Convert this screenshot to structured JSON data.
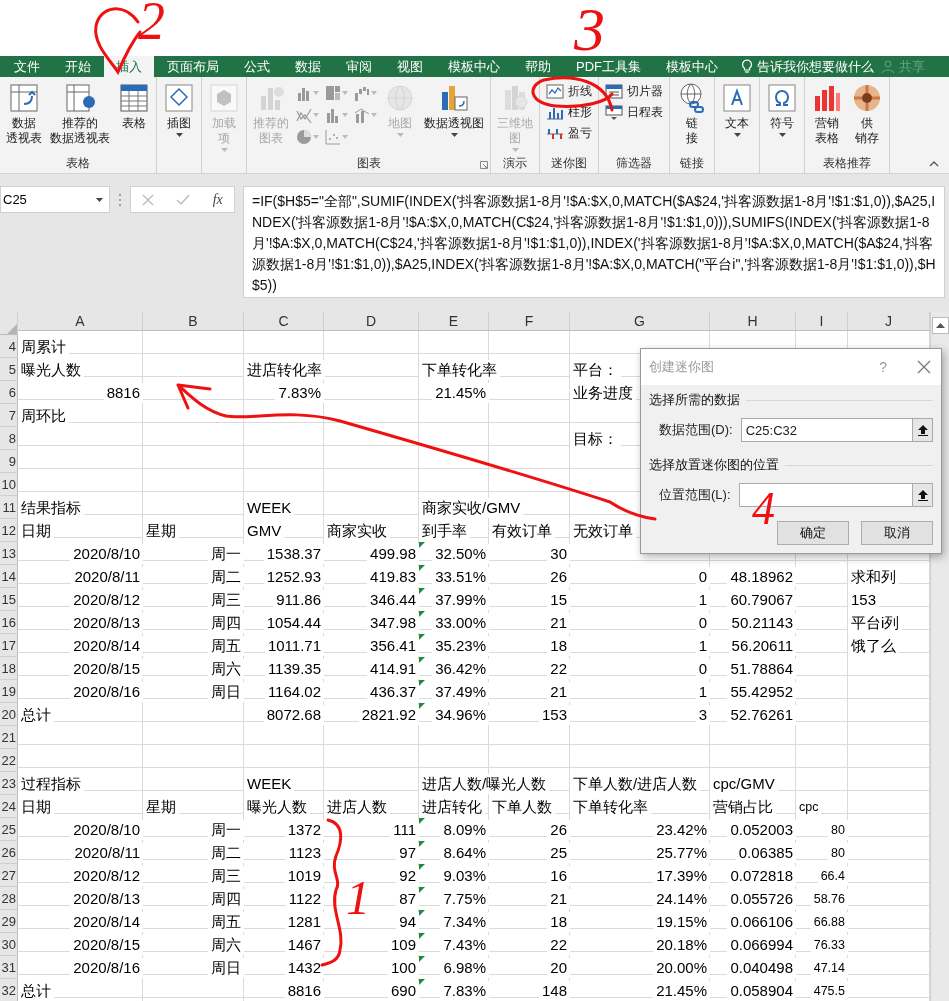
{
  "tabs": [
    {
      "label": "文件",
      "selected": false
    },
    {
      "label": "开始",
      "selected": false
    },
    {
      "label": "插入",
      "selected": true
    },
    {
      "label": "页面布局",
      "selected": false
    },
    {
      "label": "公式",
      "selected": false
    },
    {
      "label": "数据",
      "selected": false
    },
    {
      "label": "审阅",
      "selected": false
    },
    {
      "label": "视图",
      "selected": false
    },
    {
      "label": "模板中心",
      "selected": false
    },
    {
      "label": "帮助",
      "selected": false
    },
    {
      "label": "PDF工具集",
      "selected": false
    },
    {
      "label": "模板中心",
      "selected": false
    }
  ],
  "tell_me": "告诉我你想要做什么",
  "share": "共享",
  "ribbon": {
    "groups": [
      {
        "label": "表格",
        "launcher": false,
        "buttons": [
          {
            "kind": "large",
            "label": [
              "数据",
              "透视表"
            ],
            "disabled": false,
            "dropdown": false
          },
          {
            "kind": "large",
            "label": [
              "推荐的",
              "数据透视表"
            ],
            "disabled": false,
            "dropdown": false
          },
          {
            "kind": "large",
            "label": [
              "表格"
            ],
            "disabled": false,
            "dropdown": false
          }
        ]
      },
      {
        "launcher": false,
        "buttons": [
          {
            "kind": "large",
            "label": [
              "插图"
            ],
            "disabled": false,
            "dropdown": true
          }
        ]
      },
      {
        "launcher": false,
        "buttons": [
          {
            "kind": "large",
            "label": [
              "加载",
              "项"
            ],
            "disabled": true,
            "dropdown": true
          }
        ]
      },
      {
        "label": "图表",
        "launcher": true,
        "buttons": [
          {
            "kind": "large",
            "label": [
              "推荐的",
              "图表"
            ],
            "disabled": true,
            "dropdown": false
          },
          {
            "kind": "icon",
            "disabled": true,
            "dropdown": true
          },
          {
            "kind": "icon",
            "disabled": true,
            "dropdown": true
          },
          {
            "kind": "icon",
            "disabled": true,
            "dropdown": true
          },
          {
            "kind": "icon",
            "disabled": true,
            "dropdown": true
          },
          {
            "kind": "icon",
            "disabled": true,
            "dropdown": true
          },
          {
            "kind": "icon",
            "disabled": true,
            "dropdown": true
          },
          {
            "kind": "icon",
            "disabled": true,
            "dropdown": true
          },
          {
            "kind": "icon",
            "disabled": true,
            "dropdown": true
          },
          {
            "kind": "large",
            "label": [
              "地图"
            ],
            "disabled": true,
            "dropdown": true
          },
          {
            "kind": "large",
            "label": [
              "数据透视图"
            ],
            "disabled": false,
            "dropdown": true
          }
        ]
      },
      {
        "label": "演示",
        "launcher": false,
        "buttons": [
          {
            "kind": "large",
            "label": [
              "三维地",
              "图"
            ],
            "disabled": true,
            "dropdown": true
          }
        ]
      },
      {
        "label": "迷你图",
        "launcher": false,
        "buttons": [
          {
            "kind": "small",
            "label": [
              "折线"
            ],
            "disabled": false,
            "dropdown": false
          },
          {
            "kind": "small",
            "label": [
              "柱形"
            ],
            "disabled": false,
            "dropdown": false
          },
          {
            "kind": "small",
            "label": [
              "盈亏"
            ],
            "disabled": false,
            "dropdown": false
          }
        ]
      },
      {
        "label": "筛选器",
        "launcher": false,
        "buttons": [
          {
            "kind": "small",
            "label": [
              "切片器"
            ],
            "disabled": false,
            "dropdown": false
          },
          {
            "kind": "small",
            "label": [
              "日程表"
            ],
            "disabled": false,
            "dropdown": false
          }
        ]
      },
      {
        "label": "链接",
        "launcher": false,
        "buttons": [
          {
            "kind": "large",
            "label": [
              "链",
              "接"
            ],
            "disabled": false,
            "dropdown": false
          }
        ]
      },
      {
        "launcher": false,
        "buttons": [
          {
            "kind": "large",
            "label": [
              "文本"
            ],
            "disabled": false,
            "dropdown": true
          }
        ]
      },
      {
        "launcher": false,
        "buttons": [
          {
            "kind": "large",
            "label": [
              "符号"
            ],
            "disabled": false,
            "dropdown": true
          }
        ]
      },
      {
        "label": "表格推荐",
        "launcher": false,
        "buttons": [
          {
            "kind": "large",
            "label": [
              "营销",
              "表格"
            ],
            "disabled": false,
            "dropdown": false
          },
          {
            "kind": "large",
            "label": [
              "供",
              "销存"
            ],
            "disabled": false,
            "dropdown": false
          }
        ]
      }
    ]
  },
  "formula_bar": {
    "name_box": "C25",
    "function_label": "fx",
    "formula": "=IF($H$5=\"全部\",SUMIF(INDEX('抖客源数据1-8月'!$A:$X,0,MATCH($A$24,'抖客源数据1-8月'!$1:$1,0)),$A25,INDEX('抖客源数据1-8月'!$A:$X,0,MATCH(C$24,'抖客源数据1-8月'!$1:$1,0))),SUMIFS(INDEX('抖客源数据1-8月'!$A:$X,0,MATCH(C$24,'抖客源数据1-8月'!$1:$1,0)),INDEX('抖客源数据1-8月'!$A:$X,0,MATCH($A$24,'抖客源数据1-8月'!$1:$1,0)),$A25,INDEX('抖客源数据1-8月'!$A:$X,0,MATCH(\"平台i\",'抖客源数据1-8月'!$1:$1,0)),$H$5))"
  },
  "sheet": {
    "columns": [
      "A",
      "B",
      "C",
      "D",
      "E",
      "F",
      "G",
      "H",
      "I",
      "J"
    ],
    "rows": [
      {
        "number": "4",
        "kind": "text",
        "error_flag": false,
        "cells": [
          "周累计",
          null,
          null,
          null,
          null,
          null,
          null,
          null,
          null,
          null
        ]
      },
      {
        "number": "5",
        "kind": "text",
        "error_flag": false,
        "cells": [
          "曝光人数",
          null,
          "进店转化率",
          null,
          "下单转化率",
          null,
          "平台：",
          null,
          null,
          null
        ]
      },
      {
        "number": "6",
        "kind": "summary",
        "error_flag": false,
        "cells": [
          "8816",
          null,
          "7.83%",
          null,
          "21.45%",
          null,
          "业务进度",
          null,
          null,
          null
        ]
      },
      {
        "number": "7",
        "kind": "text",
        "error_flag": false,
        "cells": [
          "周环比",
          null,
          null,
          null,
          null,
          null,
          null,
          null,
          null,
          null
        ]
      },
      {
        "number": "8",
        "kind": "text",
        "error_flag": false,
        "cells": [
          null,
          null,
          null,
          null,
          null,
          null,
          "目标：",
          null,
          null,
          null
        ]
      },
      {
        "number": "9",
        "kind": "text",
        "error_flag": false,
        "cells": [
          null,
          null,
          null,
          null,
          null,
          null,
          null,
          null,
          null,
          null
        ]
      },
      {
        "number": "10",
        "kind": "text",
        "error_flag": false,
        "cells": [
          null,
          null,
          null,
          null,
          null,
          null,
          null,
          null,
          null,
          null
        ]
      },
      {
        "number": "11",
        "kind": "text",
        "error_flag": false,
        "cells": [
          "结果指标",
          null,
          "WEEK",
          null,
          "商家实收/GMV",
          null,
          null,
          null,
          null,
          null
        ]
      },
      {
        "number": "12",
        "kind": "text",
        "error_flag": false,
        "cells": [
          "日期",
          "星期",
          "GMV",
          "商家实收",
          "到手率",
          "有效订单",
          "无效订单",
          null,
          null,
          null
        ]
      },
      {
        "number": "13",
        "kind": "data",
        "error_flag": true,
        "cells": [
          "2020/8/10",
          "周一",
          "1538.37",
          "499.98",
          "32.50%",
          "30",
          null,
          null,
          null,
          null
        ]
      },
      {
        "number": "14",
        "kind": "data",
        "error_flag": true,
        "cells": [
          "2020/8/11",
          "周二",
          "1252.93",
          "419.83",
          "33.51%",
          "26",
          "0",
          "48.18962",
          null,
          "求和列"
        ]
      },
      {
        "number": "15",
        "kind": "data",
        "error_flag": true,
        "cells": [
          "2020/8/12",
          "周三",
          "911.86",
          "346.44",
          "37.99%",
          "15",
          "1",
          "60.79067",
          null,
          "153"
        ]
      },
      {
        "number": "16",
        "kind": "data",
        "error_flag": true,
        "cells": [
          "2020/8/13",
          "周四",
          "1054.44",
          "347.98",
          "33.00%",
          "21",
          "0",
          "50.21143",
          null,
          "平台i列"
        ]
      },
      {
        "number": "17",
        "kind": "data",
        "error_flag": true,
        "cells": [
          "2020/8/14",
          "周五",
          "1011.71",
          "356.41",
          "35.23%",
          "18",
          "1",
          "56.20611",
          null,
          "饿了么"
        ]
      },
      {
        "number": "18",
        "kind": "data",
        "error_flag": true,
        "cells": [
          "2020/8/15",
          "周六",
          "1139.35",
          "414.91",
          "36.42%",
          "22",
          "0",
          "51.78864",
          null,
          null
        ]
      },
      {
        "number": "19",
        "kind": "data",
        "error_flag": true,
        "cells": [
          "2020/8/16",
          "周日",
          "1164.02",
          "436.37",
          "37.49%",
          "21",
          "1",
          "55.42952",
          null,
          null
        ]
      },
      {
        "number": "20",
        "kind": "total",
        "error_flag": true,
        "cells": [
          "总计",
          null,
          "8072.68",
          "2821.92",
          "34.96%",
          "153",
          "3",
          "52.76261",
          null,
          null
        ]
      },
      {
        "number": "21",
        "kind": "text",
        "error_flag": false,
        "cells": [
          null,
          null,
          null,
          null,
          null,
          null,
          null,
          null,
          null,
          null
        ]
      },
      {
        "number": "22",
        "kind": "text",
        "error_flag": false,
        "cells": [
          null,
          null,
          null,
          null,
          null,
          null,
          null,
          null,
          null,
          null
        ]
      },
      {
        "number": "23",
        "kind": "text",
        "error_flag": false,
        "cells": [
          "过程指标",
          null,
          "WEEK",
          null,
          "进店人数/曝光人数",
          null,
          "下单人数/进店人数",
          "cpc/GMV",
          null,
          null
        ]
      },
      {
        "number": "24",
        "kind": "text",
        "error_flag": false,
        "cells": [
          "日期",
          "星期",
          "曝光人数",
          "进店人数",
          "进店转化",
          "下单人数",
          "下单转化率",
          "营销占比",
          "cpc",
          null
        ]
      },
      {
        "number": "25",
        "kind": "data",
        "error_flag": true,
        "cells": [
          "2020/8/10",
          "周一",
          "1372",
          "111",
          "8.09%",
          "26",
          "23.42%",
          "0.052003",
          "80",
          null
        ]
      },
      {
        "number": "26",
        "kind": "data",
        "error_flag": true,
        "cells": [
          "2020/8/11",
          "周二",
          "1123",
          "97",
          "8.64%",
          "25",
          "25.77%",
          "0.06385",
          "80",
          null
        ]
      },
      {
        "number": "27",
        "kind": "data",
        "error_flag": true,
        "cells": [
          "2020/8/12",
          "周三",
          "1019",
          "92",
          "9.03%",
          "16",
          "17.39%",
          "0.072818",
          "66.4",
          null
        ]
      },
      {
        "number": "28",
        "kind": "data",
        "error_flag": true,
        "cells": [
          "2020/8/13",
          "周四",
          "1122",
          "87",
          "7.75%",
          "21",
          "24.14%",
          "0.055726",
          "58.76",
          null
        ]
      },
      {
        "number": "29",
        "kind": "data",
        "error_flag": true,
        "cells": [
          "2020/8/14",
          "周五",
          "1281",
          "94",
          "7.34%",
          "18",
          "19.15%",
          "0.066106",
          "66.88",
          null
        ]
      },
      {
        "number": "30",
        "kind": "data",
        "error_flag": true,
        "cells": [
          "2020/8/15",
          "周六",
          "1467",
          "109",
          "7.43%",
          "22",
          "20.18%",
          "0.066994",
          "76.33",
          null
        ]
      },
      {
        "number": "31",
        "kind": "data",
        "error_flag": true,
        "cells": [
          "2020/8/16",
          "周日",
          "1432",
          "100",
          "6.98%",
          "20",
          "20.00%",
          "0.040498",
          "47.14",
          null
        ]
      },
      {
        "number": "32",
        "kind": "total",
        "error_flag": true,
        "cells": [
          "总计",
          null,
          "8816",
          "690",
          "7.83%",
          "148",
          "21.45%",
          "0.058904",
          "475.5",
          null
        ]
      }
    ]
  },
  "dialog": {
    "title": "创建迷你图",
    "help": "?",
    "sections": [
      {
        "heading": "选择所需的数据",
        "label": "数据范围(D):",
        "value": "C25:C32"
      },
      {
        "heading": "选择放置迷你图的位置",
        "label": "位置范围(L):"
      }
    ],
    "buttons": [
      "确定",
      "取消"
    ]
  },
  "annotations": [
    "2",
    "3",
    "4",
    "1"
  ]
}
